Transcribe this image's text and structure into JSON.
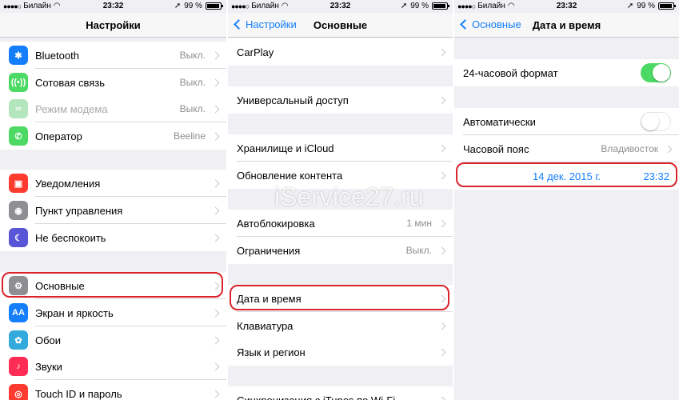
{
  "status": {
    "carrier": "Билайн",
    "time": "23:32",
    "battery": "99 %",
    "signal_dots": "●●●●○"
  },
  "colors": {
    "accent": "#157efb",
    "toggle_on": "#4cd964",
    "highlight": "#d9242b"
  },
  "watermark": "iService27.ru",
  "settings": {
    "title": "Настройки",
    "items": [
      {
        "label": "Bluetooth",
        "value": "Выкл.",
        "icon": "bluetooth-icon",
        "color": "#157efb",
        "glyph": "✱"
      },
      {
        "label": "Сотовая связь",
        "value": "Выкл.",
        "icon": "cellular-icon",
        "color": "#4cd964",
        "glyph": "((•))"
      },
      {
        "label": "Режим модема",
        "value": "Выкл.",
        "icon": "hotspot-icon",
        "color": "#b3e6bd",
        "glyph": "∞"
      },
      {
        "label": "Оператор",
        "value": "Beeline",
        "icon": "phone-icon",
        "color": "#4cd964",
        "glyph": "✆"
      },
      {
        "label": "Уведомления",
        "value": "",
        "icon": "notifications-icon",
        "color": "#ff3b30",
        "glyph": "▣"
      },
      {
        "label": "Пункт управления",
        "value": "",
        "icon": "control-center-icon",
        "color": "#8e8e93",
        "glyph": "◉"
      },
      {
        "label": "Не беспокоить",
        "value": "",
        "icon": "moon-icon",
        "color": "#5856d6",
        "glyph": "☾"
      },
      {
        "label": "Основные",
        "value": "",
        "icon": "gear-icon",
        "color": "#8e8e93",
        "glyph": "⚙"
      },
      {
        "label": "Экран и яркость",
        "value": "",
        "icon": "display-icon",
        "color": "#157efb",
        "glyph": "AA"
      },
      {
        "label": "Обои",
        "value": "",
        "icon": "wallpaper-icon",
        "color": "#34aadc",
        "glyph": "✿"
      },
      {
        "label": "Звуки",
        "value": "",
        "icon": "sounds-icon",
        "color": "#ff2d55",
        "glyph": "♪"
      },
      {
        "label": "Touch ID и пароль",
        "value": "",
        "icon": "fingerprint-icon",
        "color": "#ff3b30",
        "glyph": "◎"
      }
    ]
  },
  "general": {
    "back": "Настройки",
    "title": "Основные",
    "items": [
      {
        "label": "CarPlay",
        "value": ""
      },
      {
        "label": "Универсальный доступ",
        "value": ""
      },
      {
        "label": "Хранилище и iCloud",
        "value": ""
      },
      {
        "label": "Обновление контента",
        "value": ""
      },
      {
        "label": "Автоблокировка",
        "value": "1 мин"
      },
      {
        "label": "Ограничения",
        "value": "Выкл."
      },
      {
        "label": "Дата и время",
        "value": ""
      },
      {
        "label": "Клавиатура",
        "value": ""
      },
      {
        "label": "Язык и регион",
        "value": ""
      },
      {
        "label": "Синхронизация с iTunes по Wi-Fi",
        "value": ""
      }
    ]
  },
  "datetime": {
    "back": "Основные",
    "title": "Дата и время",
    "format24_label": "24-часовой формат",
    "format24_on": true,
    "auto_label": "Автоматически",
    "auto_on": false,
    "timezone_label": "Часовой пояс",
    "timezone_value": "Владивосток",
    "date": "14 дек. 2015 г.",
    "time": "23:32"
  }
}
